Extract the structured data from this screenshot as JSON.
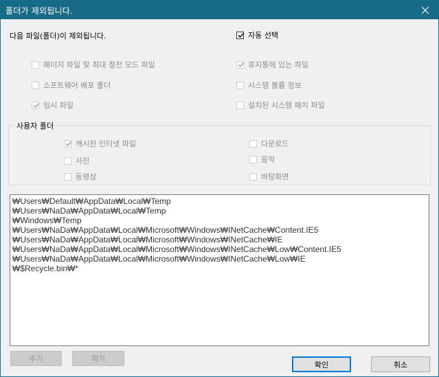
{
  "window": {
    "title": "폴더가 제외됩니다."
  },
  "intro": {
    "text": "다음 파일(폴더)이 제외됩니다.",
    "auto_select_label": "자동 선택",
    "auto_select_checked": true
  },
  "options": [
    {
      "label": "페이지 파일 및 최대 절전 모드 파일",
      "checked": false
    },
    {
      "label": "휴지통에 있는 파일",
      "checked": true
    },
    {
      "label": "소프트웨어 배포 폴더",
      "checked": false
    },
    {
      "label": "시스템 볼륨 정보",
      "checked": false
    },
    {
      "label": "임시 파일",
      "checked": true
    },
    {
      "label": "설치된 시스템 패치 파일",
      "checked": false
    }
  ],
  "user_folders": {
    "title": "사용자 폴더",
    "items": [
      {
        "label": "캐시된 인터넷 파일",
        "checked": true
      },
      {
        "label": "다운로드",
        "checked": false
      },
      {
        "label": "사진",
        "checked": false
      },
      {
        "label": "음악",
        "checked": false
      },
      {
        "label": "동영상",
        "checked": false
      },
      {
        "label": "바탕화면",
        "checked": false
      }
    ]
  },
  "paths": [
    "₩Users₩Default₩AppData₩Local₩Temp",
    "₩Users₩NaDa₩AppData₩Local₩Temp",
    "₩Windows₩Temp",
    "₩Users₩NaDa₩AppData₩Local₩Microsoft₩Windows₩INetCache₩Content.IE5",
    "₩Users₩NaDa₩AppData₩Local₩Microsoft₩Windows₩INetCache₩IE",
    "₩Users₩NaDa₩AppData₩Local₩Microsoft₩Windows₩INetCache₩Low₩Content.IE5",
    "₩Users₩NaDa₩AppData₩Local₩Microsoft₩Windows₩INetCache₩Low₩IE",
    "₩$Recycle.bin₩*"
  ],
  "buttons": {
    "add": "추가",
    "remove": "제거",
    "ok": "확인",
    "cancel": "취소"
  },
  "colors": {
    "titlebar": "#176b87",
    "accent": "#0078d7"
  }
}
